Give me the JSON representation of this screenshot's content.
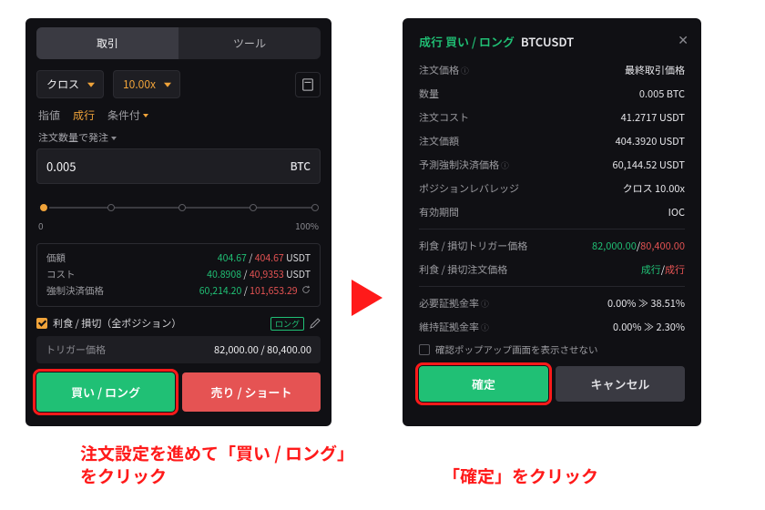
{
  "left": {
    "tabs": {
      "trade": "取引",
      "tool": "ツール"
    },
    "margin_mode": "クロス",
    "leverage": "10.00x",
    "order_types": {
      "limit": "指値",
      "market": "成行",
      "conditional": "条件付"
    },
    "qty_label": "注文数量で発注",
    "qty_value": "0.005",
    "qty_unit": "BTC",
    "slider": {
      "min": "0",
      "max": "100%"
    },
    "stats": {
      "price_label": "価額",
      "price_buy": "404.67",
      "price_sell": "404.67",
      "price_unit": "USDT",
      "cost_label": "コスト",
      "cost_buy": "40.8908",
      "cost_sell": "40,9353",
      "cost_unit": "USDT",
      "liq_label": "強制決済価格",
      "liq_buy": "60,214.20",
      "liq_sell": "101,653.29"
    },
    "tp_label": "利食 / 損切（全ポジション）",
    "tp_badge": "ロング",
    "trigger_label": "トリガー価格",
    "trigger_value": "82,000.00 / 80,400.00",
    "buy_btn": "買い / ロング",
    "sell_btn": "売り / ショート"
  },
  "right": {
    "title_prefix": "成行 買い / ロング",
    "pair": "BTCUSDT",
    "rows": {
      "order_price_k": "注文価格",
      "order_price_v": "最終取引価格",
      "qty_k": "数量",
      "qty_v": "0.005 BTC",
      "cost_k": "注文コスト",
      "cost_v": "41.2717 USDT",
      "value_k": "注文価額",
      "value_v": "404.3920 USDT",
      "liq_k": "予測強制決済価格",
      "liq_v": "60,144.52 USDT",
      "lev_k": "ポジションレバレッジ",
      "lev_v": "クロス 10.00x",
      "tif_k": "有効期間",
      "tif_v": "IOC",
      "tp_trigger_k": "利食 / 損切トリガー価格",
      "tp_trigger_buy": "82,000.00",
      "tp_trigger_sell": "80,400.00",
      "tp_price_k": "利食 / 損切注文価格",
      "tp_price_buy": "成行",
      "tp_price_sell": "成行",
      "margin_req_k": "必要証拠金率",
      "margin_req_from": "0.00%",
      "margin_req_to": "38.51%",
      "margin_maint_k": "維持証拠金率",
      "margin_maint_from": "0.00%",
      "margin_maint_to": "2.30%"
    },
    "dont_show": "確認ポップアップ画面を表示させない",
    "confirm_btn": "確定",
    "cancel_btn": "キャンセル"
  },
  "captions": {
    "left": "注文設定を進めて「買い / ロング」をクリック",
    "right": "「確定」をクリック"
  }
}
